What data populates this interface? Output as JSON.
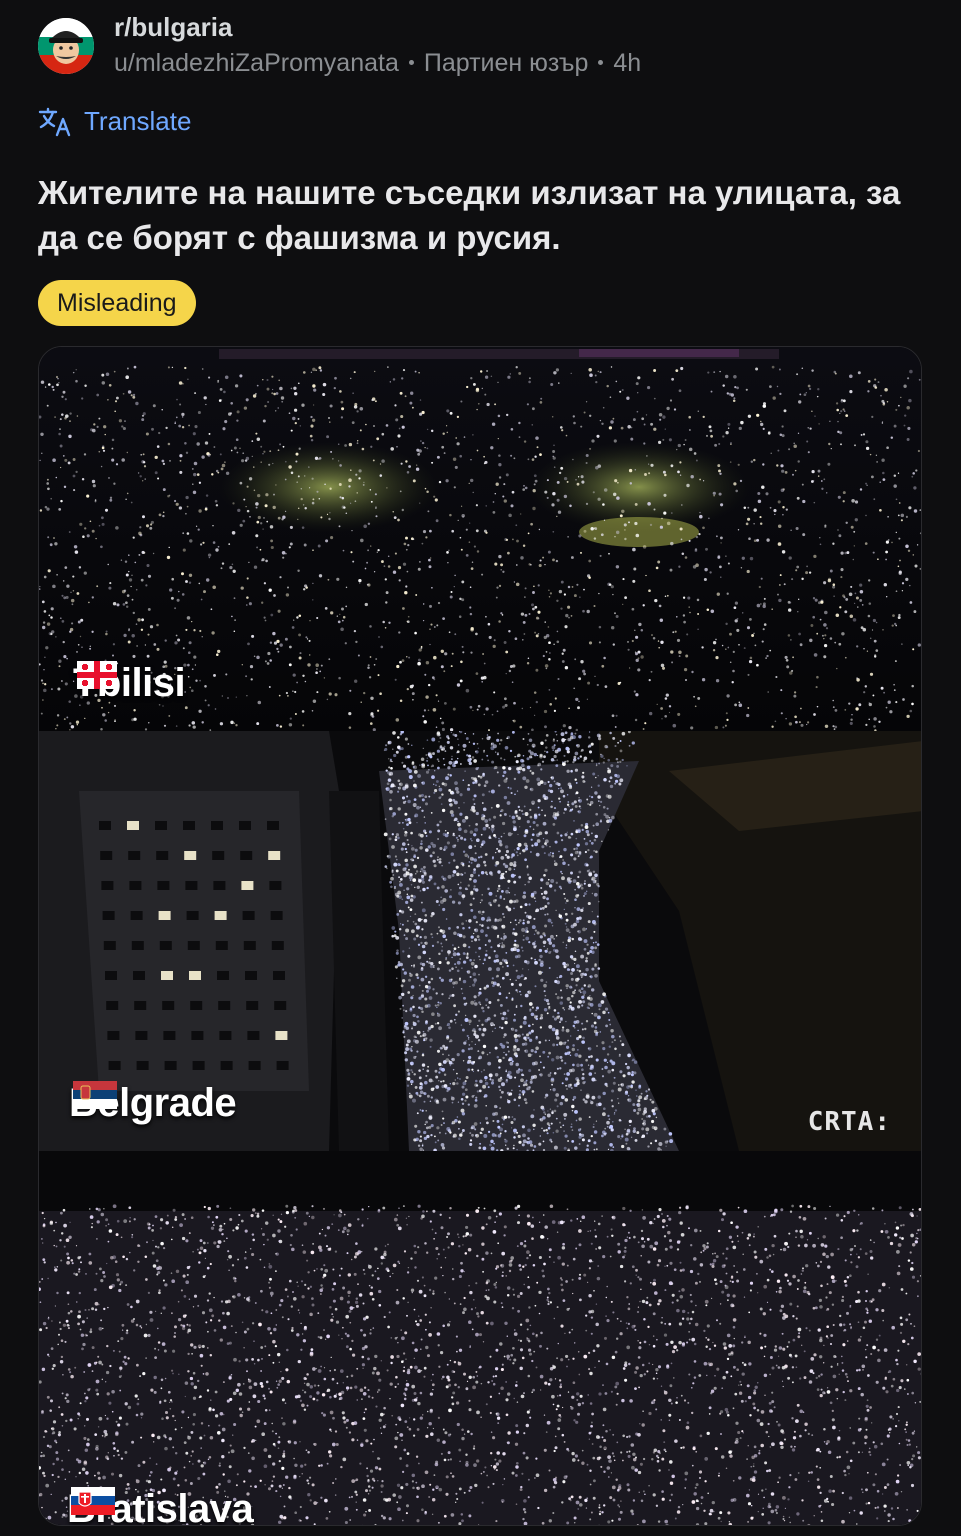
{
  "post": {
    "subreddit": "r/bulgaria",
    "author": "u/mladezhiZaPromyanata",
    "author_flair": "Партиен юзър",
    "age": "4h",
    "translate_label": "Translate",
    "title": "Жителите на нашите съседки излизат на улицата, за да се борят с фашизма и русия.",
    "flair": "Misleading",
    "flair_color": "#f5d54a"
  },
  "media": {
    "panels": [
      {
        "city": "Tbilisi",
        "flag": "georgia-flag"
      },
      {
        "city": "Belgrade",
        "flag": "serbia-flag",
        "watermark": "CRTA:"
      },
      {
        "city": "Bratislava",
        "flag": "slovakia-flag"
      }
    ]
  },
  "colors": {
    "background": "#0e0e10",
    "link": "#6fa8ff"
  }
}
